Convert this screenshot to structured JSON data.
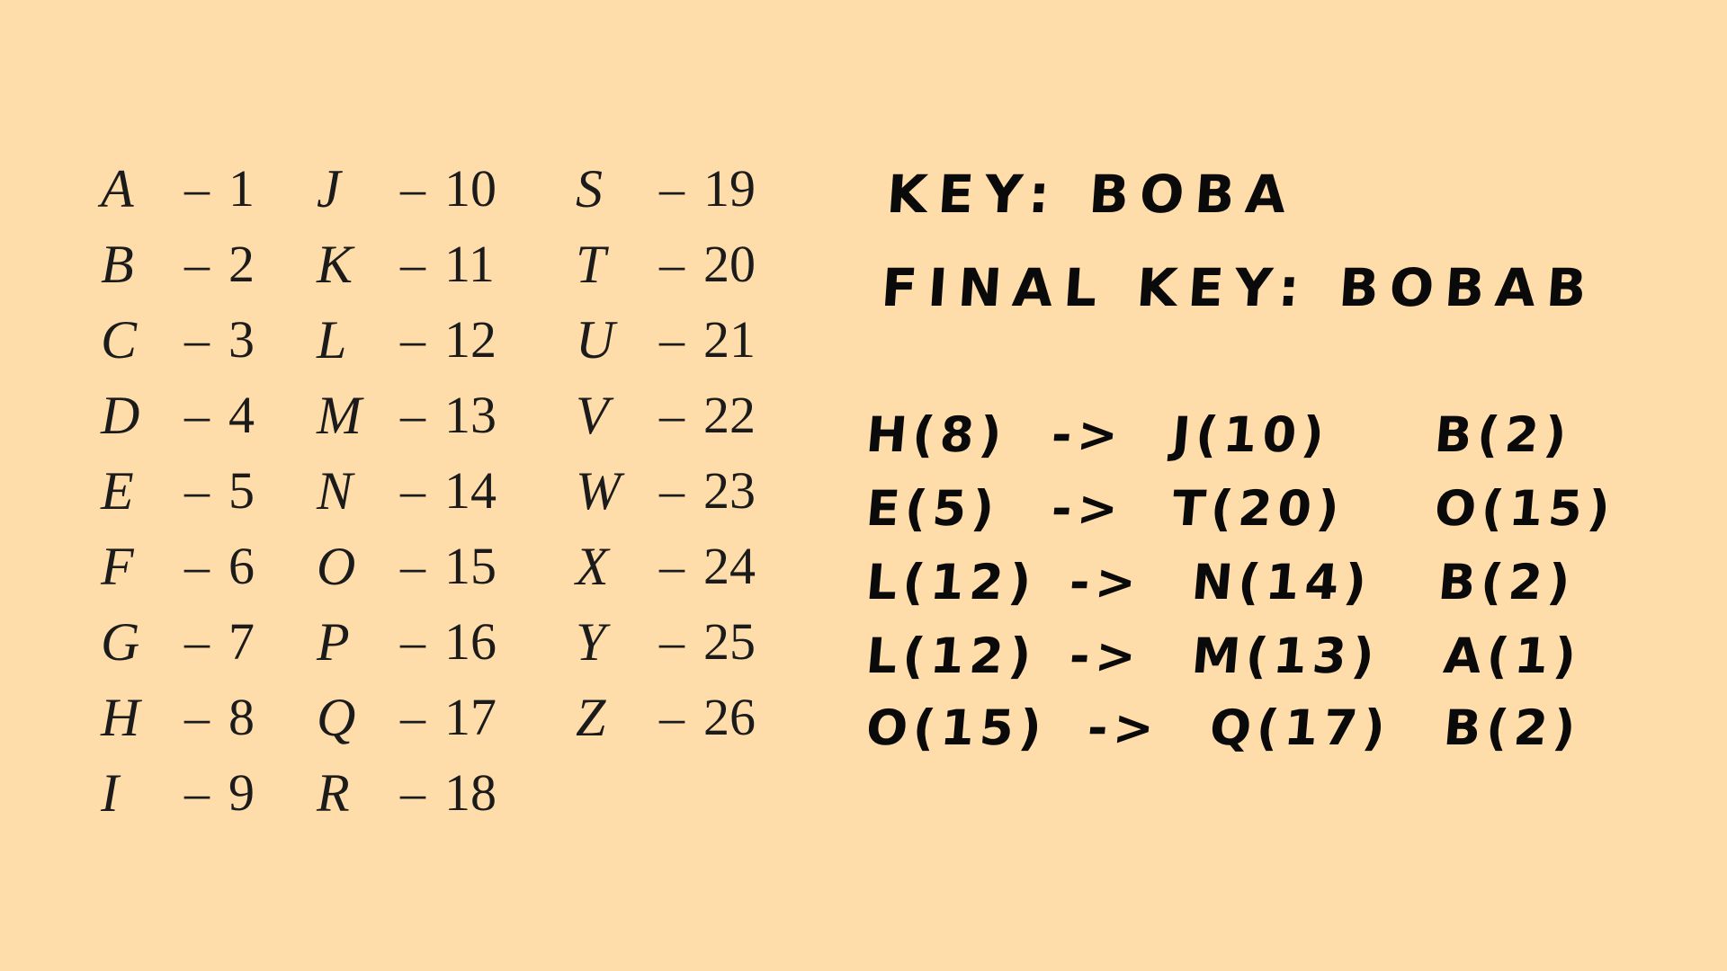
{
  "colors": {
    "background": "#ffddaa",
    "ink": "#0a0a0a",
    "table_text": "#1b1b1b"
  },
  "alphabet_table": {
    "columns": [
      [
        {
          "letter": "A",
          "dash": "–",
          "num": "1"
        },
        {
          "letter": "B",
          "dash": "–",
          "num": "2"
        },
        {
          "letter": "C",
          "dash": "–",
          "num": "3"
        },
        {
          "letter": "D",
          "dash": "–",
          "num": "4"
        },
        {
          "letter": "E",
          "dash": "–",
          "num": "5"
        },
        {
          "letter": "F",
          "dash": "–",
          "num": "6"
        },
        {
          "letter": "G",
          "dash": "–",
          "num": "7"
        },
        {
          "letter": "H",
          "dash": "–",
          "num": "8"
        },
        {
          "letter": "I",
          "dash": "–",
          "num": "9"
        }
      ],
      [
        {
          "letter": "J",
          "dash": "–",
          "num": "10"
        },
        {
          "letter": "K",
          "dash": "–",
          "num": "11"
        },
        {
          "letter": "L",
          "dash": "–",
          "num": "12"
        },
        {
          "letter": "M",
          "dash": "–",
          "num": "13"
        },
        {
          "letter": "N",
          "dash": "–",
          "num": "14"
        },
        {
          "letter": "O",
          "dash": "–",
          "num": "15"
        },
        {
          "letter": "P",
          "dash": "–",
          "num": "16"
        },
        {
          "letter": "Q",
          "dash": "–",
          "num": "17"
        },
        {
          "letter": "R",
          "dash": "–",
          "num": "18"
        }
      ],
      [
        {
          "letter": "S",
          "dash": "–",
          "num": "19"
        },
        {
          "letter": "T",
          "dash": "–",
          "num": "20"
        },
        {
          "letter": "U",
          "dash": "–",
          "num": "21"
        },
        {
          "letter": "V",
          "dash": "–",
          "num": "22"
        },
        {
          "letter": "W",
          "dash": "–",
          "num": "23"
        },
        {
          "letter": "X",
          "dash": "–",
          "num": "24"
        },
        {
          "letter": "Y",
          "dash": "–",
          "num": "25"
        },
        {
          "letter": "Z",
          "dash": "–",
          "num": "26"
        }
      ]
    ]
  },
  "notes": {
    "key": "KEY: BOBA",
    "final_key": "FINAL KEY: BOBAB"
  },
  "cipher_rows": [
    {
      "src": "H(8)",
      "arrow": "->",
      "dst": "J(10)",
      "key": "B(2)"
    },
    {
      "src": "E(5)",
      "arrow": "->",
      "dst": "T(20)",
      "key": "O(15)"
    },
    {
      "src": "L(12)",
      "arrow": "->",
      "dst": "N(14)",
      "key": "B(2)"
    },
    {
      "src": "L(12)",
      "arrow": "->",
      "dst": "M(13)",
      "key": "A(1)"
    },
    {
      "src": "O(15)",
      "arrow": "->",
      "dst": "Q(17)",
      "key": "B(2)"
    }
  ]
}
